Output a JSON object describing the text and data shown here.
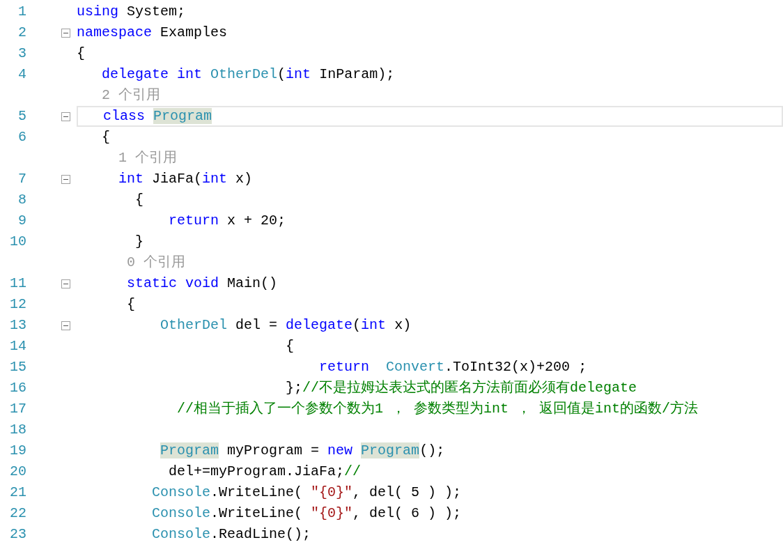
{
  "lines": [
    {
      "kind": "code",
      "number": "1",
      "tokens": [
        {
          "kind": "kw",
          "s": "using"
        },
        {
          "kind": "p",
          "s": " System;"
        }
      ]
    },
    {
      "kind": "code",
      "number": "2",
      "fold": {
        "expanded": true
      },
      "tokens": [
        {
          "kind": "kw",
          "s": "namespace"
        },
        {
          "kind": "p",
          "s": " Examples"
        }
      ]
    },
    {
      "kind": "code",
      "number": "3",
      "tokens": [
        {
          "kind": "p",
          "s": "{"
        }
      ]
    },
    {
      "kind": "code",
      "number": "4",
      "tokens": [
        {
          "kind": "kw",
          "s": "   delegate int"
        },
        {
          "kind": "type",
          "s": " OtherDel"
        },
        {
          "kind": "p",
          "s": "("
        },
        {
          "kind": "kw",
          "s": "int"
        },
        {
          "kind": "p",
          "s": " InParam);"
        }
      ]
    },
    {
      "kind": "lens",
      "text": "   2 个引用"
    },
    {
      "kind": "code",
      "number": "5",
      "current": true,
      "fold": {
        "expanded": true
      },
      "tokens": [
        {
          "kind": "kw",
          "s": "   class "
        },
        {
          "kind": "hl",
          "s": "Program"
        }
      ]
    },
    {
      "kind": "code",
      "number": "6",
      "tokens": [
        {
          "kind": "p",
          "s": "   {"
        }
      ]
    },
    {
      "kind": "lens",
      "text": "     1 个引用"
    },
    {
      "kind": "code",
      "number": "7",
      "fold": {
        "expanded": true
      },
      "tokens": [
        {
          "kind": "kw",
          "s": "     int"
        },
        {
          "kind": "p",
          "s": " JiaFa("
        },
        {
          "kind": "kw",
          "s": "int"
        },
        {
          "kind": "p",
          "s": " x)"
        }
      ]
    },
    {
      "kind": "code",
      "number": "8",
      "tokens": [
        {
          "kind": "p",
          "s": "       {"
        }
      ]
    },
    {
      "kind": "code",
      "number": "9",
      "tokens": [
        {
          "kind": "kw",
          "s": "           return"
        },
        {
          "kind": "p",
          "s": " x + 20;"
        }
      ]
    },
    {
      "kind": "code",
      "number": "10",
      "tokens": [
        {
          "kind": "p",
          "s": "       }"
        }
      ]
    },
    {
      "kind": "lens",
      "text": "      0 个引用"
    },
    {
      "kind": "code",
      "number": "11",
      "fold": {
        "expanded": true
      },
      "tokens": [
        {
          "kind": "kw",
          "s": "      static void"
        },
        {
          "kind": "p",
          "s": " Main()"
        }
      ]
    },
    {
      "kind": "code",
      "number": "12",
      "tokens": [
        {
          "kind": "p",
          "s": "      {"
        }
      ]
    },
    {
      "kind": "code",
      "number": "13",
      "fold": {
        "expanded": true
      },
      "tokens": [
        {
          "kind": "type",
          "s": "          OtherDel"
        },
        {
          "kind": "p",
          "s": " del = "
        },
        {
          "kind": "kw",
          "s": "delegate"
        },
        {
          "kind": "p",
          "s": "("
        },
        {
          "kind": "kw",
          "s": "int"
        },
        {
          "kind": "p",
          "s": " x)"
        }
      ]
    },
    {
      "kind": "code",
      "number": "14",
      "tokens": [
        {
          "kind": "p",
          "s": "                         {"
        }
      ]
    },
    {
      "kind": "code",
      "number": "15",
      "tokens": [
        {
          "kind": "kw",
          "s": "                             return  "
        },
        {
          "kind": "type",
          "s": "Convert"
        },
        {
          "kind": "p",
          "s": ".ToInt32(x)+200 ;"
        }
      ]
    },
    {
      "kind": "code",
      "number": "16",
      "tokens": [
        {
          "kind": "p",
          "s": "                         };"
        },
        {
          "kind": "cm",
          "s": "//不是拉姆达表达式的匿名方法前面必须有delegate"
        }
      ]
    },
    {
      "kind": "code",
      "number": "17",
      "tokens": [
        {
          "kind": "cm",
          "s": "            //相当于插入了一个参数个数为1 ， 参数类型为int ， 返回值是int的函数/方法"
        }
      ]
    },
    {
      "kind": "code",
      "number": "18"
    },
    {
      "kind": "code",
      "number": "19",
      "tokens": [
        {
          "kind": "hl",
          "s": "          Program"
        },
        {
          "kind": "p",
          "s": " myProgram = "
        },
        {
          "kind": "kw",
          "s": "new "
        },
        {
          "kind": "hl",
          "s": "Program"
        },
        {
          "kind": "p",
          "s": "();"
        }
      ]
    },
    {
      "kind": "code",
      "number": "20",
      "tokens": [
        {
          "kind": "p",
          "s": "           del+=myProgram.JiaFa;"
        },
        {
          "kind": "cm",
          "s": "//"
        }
      ]
    },
    {
      "kind": "code",
      "number": "21",
      "tokens": [
        {
          "kind": "type",
          "s": "         Console"
        },
        {
          "kind": "p",
          "s": ".WriteLine( "
        },
        {
          "kind": "str",
          "s": "\"{0}\""
        },
        {
          "kind": "p",
          "s": ", del( 5 ) );"
        }
      ]
    },
    {
      "kind": "code",
      "number": "22",
      "tokens": [
        {
          "kind": "type",
          "s": "         Console"
        },
        {
          "kind": "p",
          "s": ".WriteLine( "
        },
        {
          "kind": "str",
          "s": "\"{0}\""
        },
        {
          "kind": "p",
          "s": ", del( 6 ) );"
        }
      ]
    },
    {
      "kind": "code",
      "number": "23",
      "tokens": [
        {
          "kind": "type",
          "s": "         Console"
        },
        {
          "kind": "p",
          "s": ".ReadLine();"
        }
      ]
    }
  ]
}
